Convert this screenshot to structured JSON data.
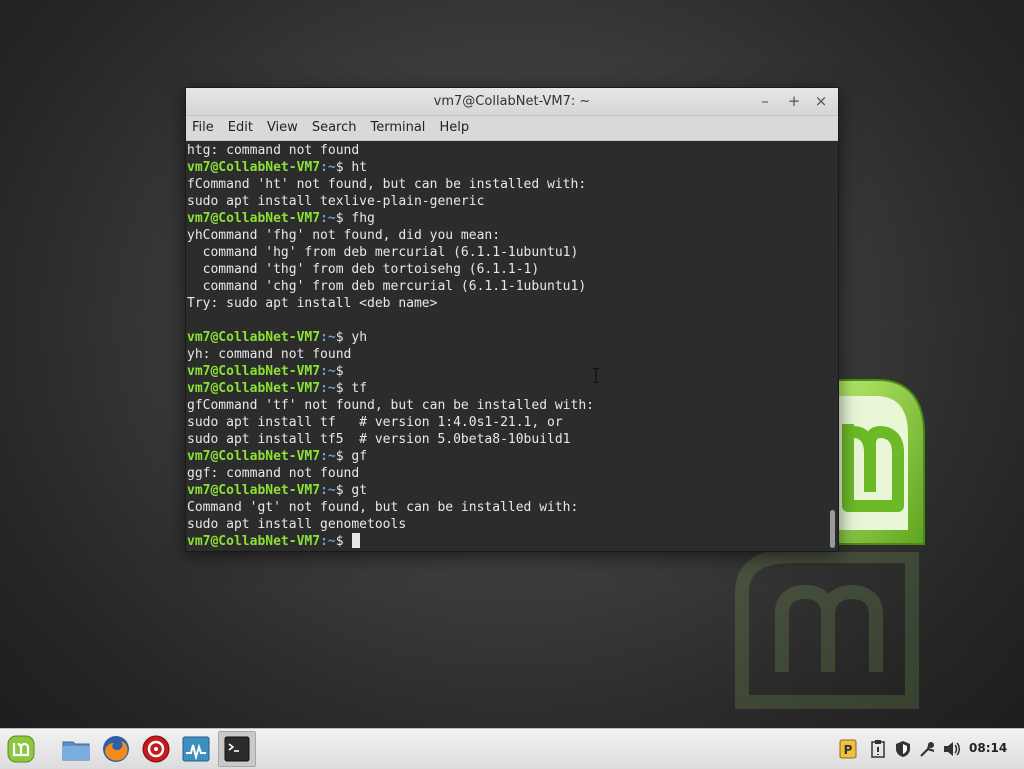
{
  "window": {
    "title": "vm7@CollabNet-VM7: ~",
    "controls": {
      "minimize": "–",
      "maximize": "+",
      "close": "×"
    }
  },
  "menubar": {
    "items": [
      "File",
      "Edit",
      "View",
      "Search",
      "Terminal",
      "Help"
    ]
  },
  "terminal": {
    "prompt_user": "vm7@CollabNet-VM7",
    "prompt_path": ":~",
    "prompt_sign": "$",
    "lines": [
      {
        "kind": "out",
        "text": "htg: command not found"
      },
      {
        "kind": "prompt",
        "cmd": " ht"
      },
      {
        "kind": "out",
        "text": "fCommand 'ht' not found, but can be installed with:"
      },
      {
        "kind": "out",
        "text": "sudo apt install texlive-plain-generic"
      },
      {
        "kind": "prompt",
        "cmd": " fhg"
      },
      {
        "kind": "out",
        "text": "yhCommand 'fhg' not found, did you mean:"
      },
      {
        "kind": "out",
        "text": "  command 'hg' from deb mercurial (6.1.1-1ubuntu1)"
      },
      {
        "kind": "out",
        "text": "  command 'thg' from deb tortoisehg (6.1.1-1)"
      },
      {
        "kind": "out",
        "text": "  command 'chg' from deb mercurial (6.1.1-1ubuntu1)"
      },
      {
        "kind": "out",
        "text": "Try: sudo apt install <deb name>"
      },
      {
        "kind": "out",
        "text": ""
      },
      {
        "kind": "prompt",
        "cmd": " yh"
      },
      {
        "kind": "out",
        "text": "yh: command not found"
      },
      {
        "kind": "prompt",
        "cmd": ""
      },
      {
        "kind": "prompt",
        "cmd": " tf"
      },
      {
        "kind": "out",
        "text": "gfCommand 'tf' not found, but can be installed with:"
      },
      {
        "kind": "out",
        "text": "sudo apt install tf   # version 1:4.0s1-21.1, or"
      },
      {
        "kind": "out",
        "text": "sudo apt install tf5  # version 5.0beta8-10build1"
      },
      {
        "kind": "prompt",
        "cmd": " gf"
      },
      {
        "kind": "out",
        "text": "ggf: command not found"
      },
      {
        "kind": "prompt",
        "cmd": " gt"
      },
      {
        "kind": "out",
        "text": "Command 'gt' not found, but can be installed with:"
      },
      {
        "kind": "out",
        "text": "sudo apt install genometools"
      },
      {
        "kind": "prompt",
        "cmd": " ",
        "cursor": true
      }
    ]
  },
  "taskbar": {
    "launchers": [
      "mint-menu-icon",
      "files-icon",
      "firefox-icon",
      "media-icon",
      "system-monitor-icon",
      "terminal-icon"
    ],
    "tray": [
      "parcellite-icon",
      "clipboard-icon",
      "shield-icon",
      "network-icon",
      "volume-icon"
    ],
    "clock": "08:14"
  },
  "colors": {
    "prompt_user": "#8ae234",
    "prompt_path": "#729fcf",
    "terminal_bg": "#2c2c2c",
    "mint_green": "#87cf3e"
  }
}
